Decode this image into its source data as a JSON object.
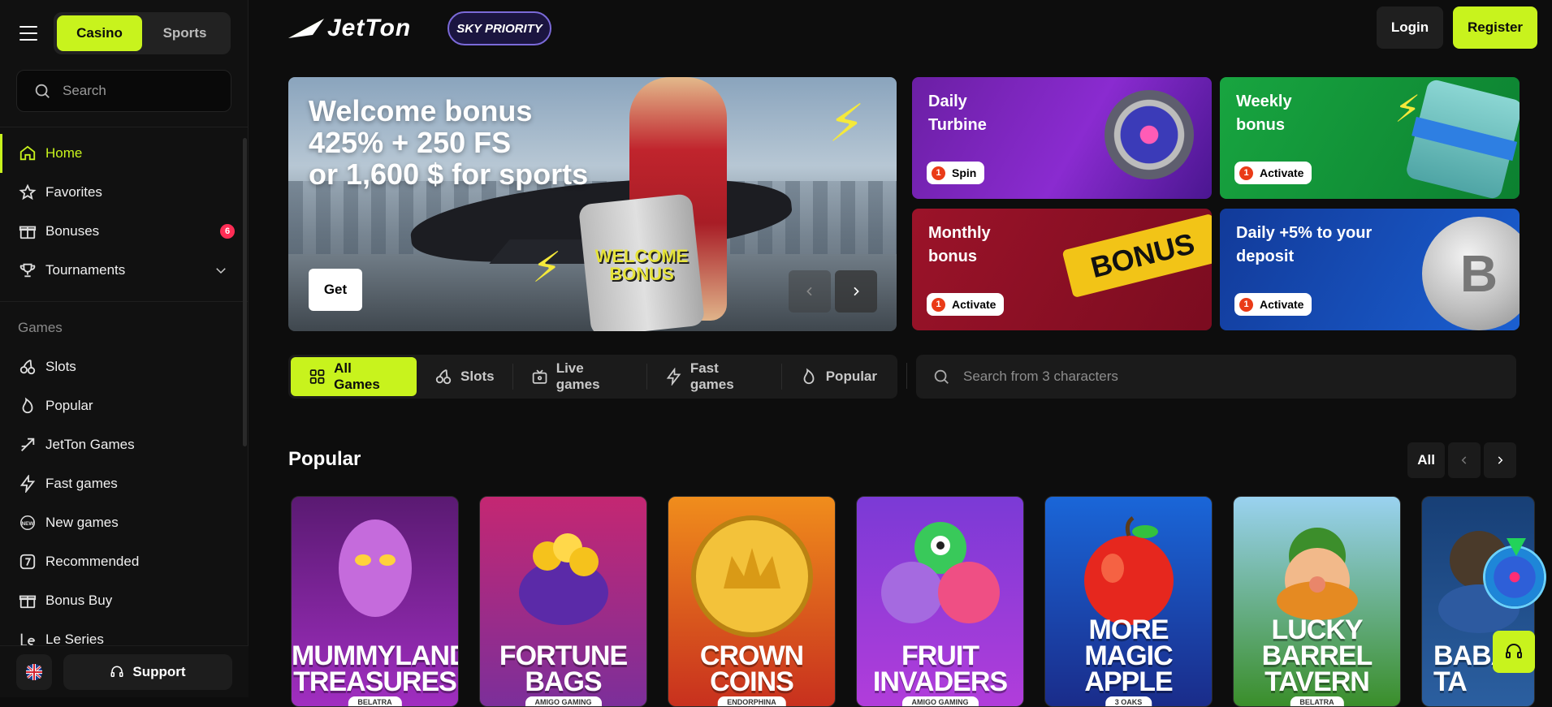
{
  "sidebar": {
    "switch": {
      "casino": "Casino",
      "sports": "Sports"
    },
    "search_placeholder": "Search",
    "nav": [
      {
        "label": "Home",
        "icon": "home-icon",
        "active": true
      },
      {
        "label": "Favorites",
        "icon": "star-icon"
      },
      {
        "label": "Bonuses",
        "icon": "gift-icon",
        "badge": "6"
      },
      {
        "label": "Tournaments",
        "icon": "trophy-icon"
      }
    ],
    "games_title": "Games",
    "games": [
      {
        "label": "Slots",
        "icon": "cherries-icon"
      },
      {
        "label": "Popular",
        "icon": "flame-icon"
      },
      {
        "label": "JetTon Games",
        "icon": "jet-icon"
      },
      {
        "label": "Fast games",
        "icon": "lightning-icon"
      },
      {
        "label": "New games",
        "icon": "new-icon"
      },
      {
        "label": "Recommended",
        "icon": "seven-icon"
      },
      {
        "label": "Bonus Buy",
        "icon": "gift-icon"
      },
      {
        "label": "Le Series",
        "icon": "le-icon"
      }
    ],
    "support": "Support"
  },
  "header": {
    "logo": "JetTon",
    "partner": "SKY PRIORITY",
    "login": "Login",
    "register": "Register"
  },
  "hero": {
    "line1": "Welcome bonus",
    "line2": "425% + 250 FS",
    "line3": "or 1,600 $ for sports",
    "suitcase": "WELCOME BONUS",
    "cta": "Get"
  },
  "promos": [
    {
      "title": "Daily Turbine",
      "action": "Spin",
      "count": "1"
    },
    {
      "title": "Weekly bonus",
      "action": "Activate",
      "count": "1"
    },
    {
      "title": "Monthly bonus",
      "action": "Activate",
      "count": "1"
    },
    {
      "title": "Daily +5% to your deposit",
      "action": "Activate",
      "count": "1"
    }
  ],
  "promo_deco": {
    "bonus_sign": "BONUS",
    "coin": "B"
  },
  "filters": {
    "all": "All Games",
    "slots": "Slots",
    "live": "Live games",
    "fast": "Fast games",
    "popular": "Popular",
    "search_placeholder": "Search from 3 characters"
  },
  "popular": {
    "title": "Popular",
    "all": "All",
    "games": [
      {
        "title": "MUMMYLAND TREASURES",
        "provider": "BELATRA",
        "bg": "#8b2aa8"
      },
      {
        "title": "FORTUNE BAGS",
        "provider": "AMIGO GAMING",
        "bg": "#8d2a86"
      },
      {
        "title": "CROWN COINS",
        "provider": "ENDORPHINA",
        "bg": "#d8531a"
      },
      {
        "title": "FRUIT INVADERS",
        "provider": "AMIGO GAMING",
        "bg": "#8c3ad9"
      },
      {
        "title": "MORE MAGIC APPLE",
        "provider": "3 OAKS",
        "bg": "#1d3fa6"
      },
      {
        "title": "LUCKY BARREL TAVERN",
        "provider": "BELATRA",
        "bg": "#3b9e2b"
      },
      {
        "title": "BABA TA",
        "provider": "",
        "bg": "#1f4c8c"
      }
    ]
  },
  "colors": {
    "accent": "#c8f31d",
    "badge": "#ff2d55",
    "background": "#0d0d0d"
  }
}
